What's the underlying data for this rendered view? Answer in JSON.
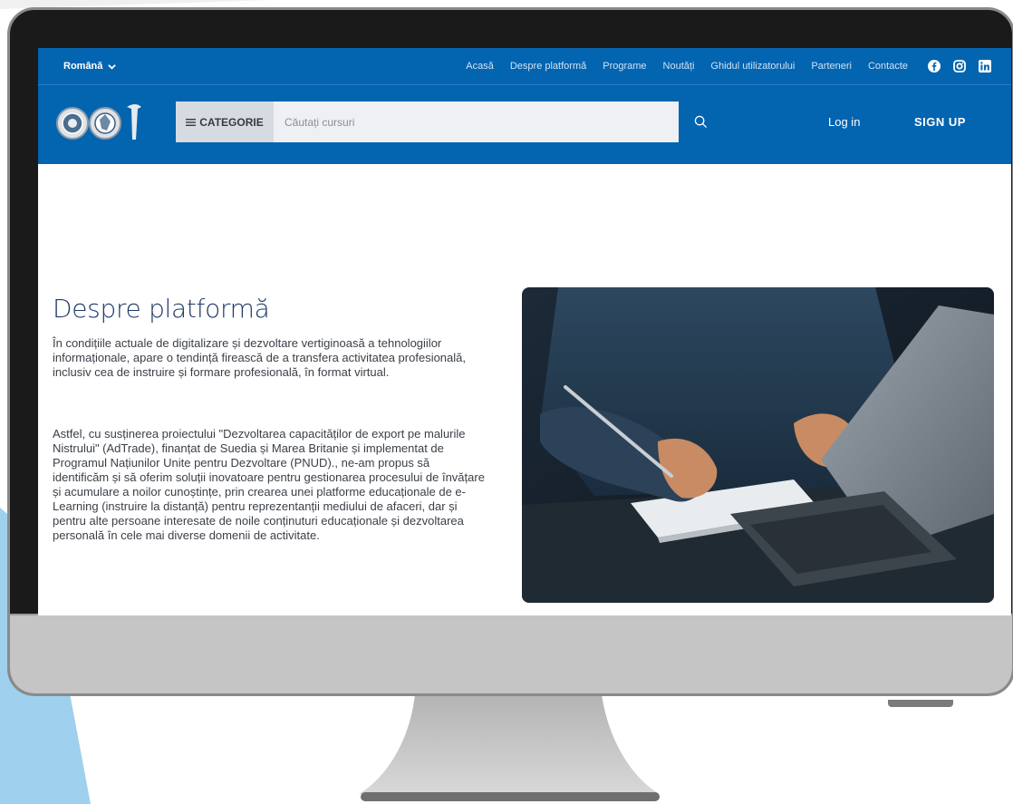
{
  "header": {
    "language": "Română",
    "nav": [
      {
        "label": "Acasă"
      },
      {
        "label": "Despre platformă"
      },
      {
        "label": "Programe"
      },
      {
        "label": "Noutăți"
      },
      {
        "label": "Ghidul utilizatorului"
      },
      {
        "label": "Parteneri"
      },
      {
        "label": "Contacte"
      }
    ],
    "social": [
      "facebook-icon",
      "instagram-icon",
      "linkedin-icon"
    ]
  },
  "search": {
    "category_label": "CATEGORIE",
    "placeholder": "Căutați cursuri"
  },
  "auth": {
    "login": "Log in",
    "signup": "SIGN UP"
  },
  "about": {
    "title": "Despre platformă",
    "paragraph1": "În condițiile actuale de digitalizare și dezvoltare vertiginoasă a tehnologiilor informaționale, apare o tendință firească de a transfera activitatea profesională, inclusiv cea de instruire și formare profesională, în format virtual.",
    "paragraph2": "Astfel, cu susținerea proiectului \"Dezvoltarea capacităților de export pe malurile Nistrului\" (AdTrade), finanțat de Suedia și Marea Britanie și implementat de Programul Națiunilor Unite pentru Dezvoltare (PNUD)., ne-am propus să  identificăm  și să oferim soluții inovatoare pentru gestionarea procesului de învățare și acumulare a noilor cunoștințe, prin crearea unei platforme educaționale de e-Learning (instruire la distanță) pentru reprezentanții mediului de afaceri, dar și pentru alte persoane interesate de noile conținuturi educaționale și dezvoltarea personală în cele mai diverse domenii de activitate."
  },
  "colors": {
    "brand_blue": "#0364b0",
    "title_blue": "#1f3a68",
    "bezel": "#1a1a1a",
    "chin": "#c5c5c5",
    "accent_light_blue": "#9fd0ee"
  }
}
